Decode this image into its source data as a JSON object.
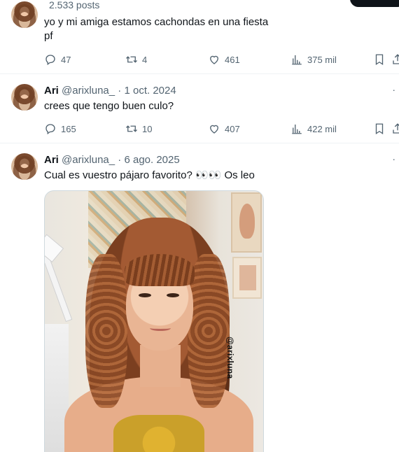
{
  "profile": {
    "post_count": "2.533 posts"
  },
  "tweets": [
    {
      "text_lines": [
        "yo y mi amiga estamos cachondas en una fiesta",
        "pf"
      ],
      "stats": {
        "replies": "47",
        "retweets": "4",
        "likes": "461",
        "views": "375 mil"
      }
    },
    {
      "name": "Ari",
      "handle": "@arixluna_",
      "separator": "·",
      "date": "1 oct. 2024",
      "text": "crees que tengo buen culo?",
      "stats": {
        "replies": "165",
        "retweets": "10",
        "likes": "407",
        "views": "422 mil"
      }
    },
    {
      "name": "Ari",
      "handle": "@arixluna_",
      "separator": "·",
      "date": "6 ago. 2025",
      "text": "Cual es vuestro pájaro favorito? 👀👀 Os leo",
      "image_watermark": "@arixluna"
    }
  ],
  "more_glyph": "·",
  "icons": [
    "reply-icon",
    "retweet-icon",
    "like-icon",
    "views-icon",
    "bookmark-icon",
    "share-icon",
    "more-icon"
  ]
}
